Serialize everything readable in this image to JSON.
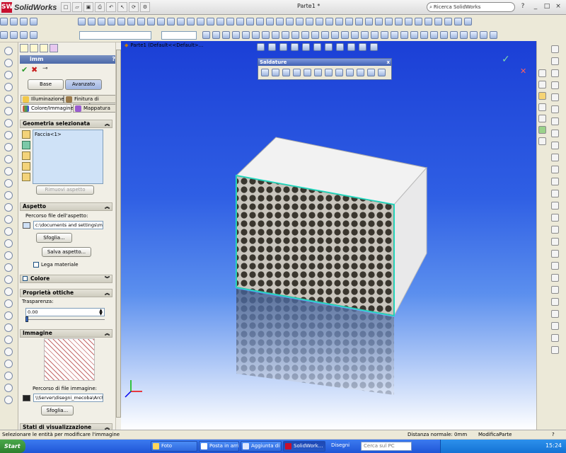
{
  "app": {
    "logo_text": "SolidWorks",
    "document_title": "Parte1 *",
    "search_placeholder": "Ricerca SolidWorks",
    "help_label": "?",
    "window_controls": [
      "_",
      "□",
      "×"
    ]
  },
  "feature_tree": {
    "label": "Parte1  (Default<<Default>..."
  },
  "property_manager": {
    "title": "imm",
    "help_label": "?",
    "mode_buttons": [
      "Base",
      "Avanzato"
    ],
    "selected_mode": "Avanzato",
    "tabs": [
      {
        "label": "Illuminazione",
        "active": false
      },
      {
        "label": "Finitura di superf...",
        "active": false
      },
      {
        "label": "Colore/Immagine",
        "active": true
      },
      {
        "label": "Mappatura",
        "active": false
      }
    ],
    "geometry": {
      "title": "Geometria selezionata",
      "items": [
        "Faccia<1>"
      ],
      "remove_button": "Rimuovi aspetto"
    },
    "appearance": {
      "title": "Aspetto",
      "path_label": "Percorso file dell'aspetto:",
      "path_value": "c:\\documents and settings\\micl",
      "browse_button": "Sfoglia...",
      "save_button": "Salva aspetto...",
      "link_label": "Lega materiale",
      "link_checked": false
    },
    "color": {
      "title": "Colore",
      "checked": false
    },
    "optical": {
      "title": "Proprietà ottiche",
      "transparency_label": "Trasparenza:",
      "transparency_value": "0.00",
      "transparency_level": 0.0
    },
    "image": {
      "title": "Immagine",
      "path_label": "Percorso di file immagine:",
      "path_value": "\\\\Server\\disegni_mecoba\\Arch.",
      "browse_button": "Sfoglia..."
    },
    "display_states": {
      "title": "Stati di visualizzazione"
    }
  },
  "saldature_toolbar": {
    "title": "Saldature",
    "close_label": "x"
  },
  "status_bar": {
    "message": "Selezionare le entità per modificare l'immagine",
    "normal_distance": "Distanza normale: 0mm",
    "mode": "ModificaParte",
    "help": "?"
  },
  "taskbar": {
    "start_label": "Start",
    "tasks": [
      {
        "label": "Foto",
        "active": false
      },
      {
        "label": "Posta in arri...",
        "active": false
      },
      {
        "label": "Aggiunta di ...",
        "active": false
      },
      {
        "label": "SolidWork...",
        "active": true
      },
      {
        "label": "Disegni",
        "active": false
      }
    ],
    "search_placeholder": "Cerca sul PC",
    "clock": "15:24"
  },
  "colors": {
    "viewport_top": "#1b3fd6",
    "viewport_bottom": "#ffffff",
    "selection_edge": "#1ee0c8",
    "taskbar": "#245edb",
    "start_button": "#3c9a3c"
  }
}
